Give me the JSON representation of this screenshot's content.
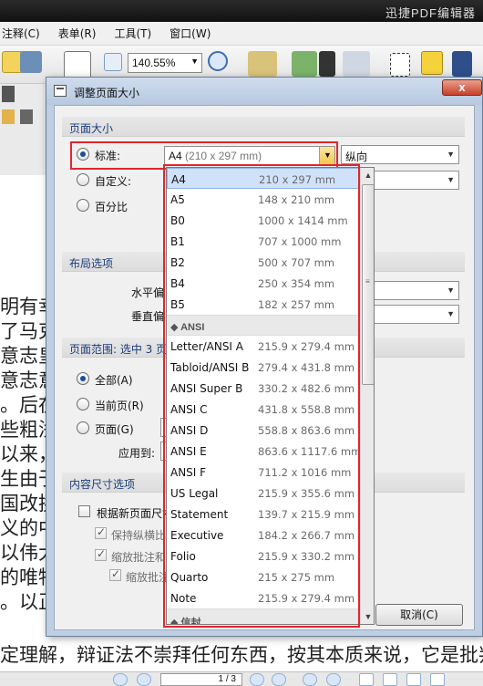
{
  "app": {
    "title": "迅捷PDF编辑器",
    "menu": [
      "注释(C)",
      "表单(R)",
      "工具(T)",
      "窗口(W)"
    ],
    "zoom": "140.55%",
    "page_indicator": "1 / 3"
  },
  "document_lines": [
    "明有幸",
    "了马克",
    "意志皇",
    "意志意",
    "。后在",
    "些粗浅",
    "以来，",
    "生由于",
    "国改换",
    "义的中",
    "以伟大",
    "的唯物",
    "。以正",
    "定理解，辩证法不崇拜任何东西，按其本质来说，它是批判"
  ],
  "dialog": {
    "title": "调整页面大小",
    "close_label": "x",
    "page_size": {
      "header": "页面大小",
      "standard_label": "标准:",
      "standard_checked": true,
      "standard_value": "A4",
      "standard_value_dim": "(210 x 297 mm)",
      "orientation": "纵向",
      "custom_label": "自定义:",
      "percent_label": "百分比"
    },
    "layout": {
      "header": "布局选项",
      "horizontal_label": "水平偏",
      "vertical_label": "垂直偏"
    },
    "page_range": {
      "header": "页面范围: 选中 3 页",
      "all_label": "全部(A)",
      "all_checked": true,
      "current_label": "当前页(R)",
      "pages_label": "页面(G)",
      "apply_to_label": "应用到:"
    },
    "content": {
      "header": "内容尺寸选项",
      "resize_label": "根据新页面尺寸",
      "keep_ratio_label": "保持纵横比",
      "scale_annotations_label": "缩放批注和",
      "scale_annotations2_label": "缩放批注"
    },
    "cancel_label": "取消(C)"
  },
  "dropdown": {
    "items": [
      {
        "name": "A4",
        "size": "210 x 297 mm",
        "selected": true
      },
      {
        "name": "A5",
        "size": "148 x 210 mm"
      },
      {
        "name": "B0",
        "size": "1000 x 1414 mm"
      },
      {
        "name": "B1",
        "size": "707 x 1000 mm"
      },
      {
        "name": "B2",
        "size": "500 x 707 mm"
      },
      {
        "name": "B4",
        "size": "250 x 354 mm"
      },
      {
        "name": "B5",
        "size": "182 x 257 mm"
      }
    ],
    "section_label": "◆ ANSI",
    "ansi_items": [
      {
        "name": "Letter/ANSI A",
        "size": "215.9 x 279.4 mm"
      },
      {
        "name": "Tabloid/ANSI B",
        "size": "279.4 x 431.8 mm"
      },
      {
        "name": "ANSI Super B",
        "size": "330.2 x 482.6 mm"
      },
      {
        "name": "ANSI C",
        "size": "431.8 x 558.8 mm"
      },
      {
        "name": "ANSI D",
        "size": "558.8 x 863.6 mm"
      },
      {
        "name": "ANSI E",
        "size": "863.6 x 1117.6 mm"
      },
      {
        "name": "ANSI F",
        "size": "711.2 x 1016 mm"
      },
      {
        "name": "US Legal",
        "size": "215.9 x 355.6 mm"
      },
      {
        "name": "Statement",
        "size": "139.7 x 215.9 mm"
      },
      {
        "name": "Executive",
        "size": "184.2 x 266.7 mm"
      },
      {
        "name": "Folio",
        "size": "215.9 x 330.2 mm"
      },
      {
        "name": "Quarto",
        "size": "215 x 275 mm"
      },
      {
        "name": "Note",
        "size": "215.9 x 279.4 mm"
      }
    ],
    "next_section_label": "◆ 信封"
  },
  "colors": {
    "highlight_box": "#e0262f",
    "selection_bg": "#cfe2f9",
    "group_header_text": "#1a3c7a"
  }
}
